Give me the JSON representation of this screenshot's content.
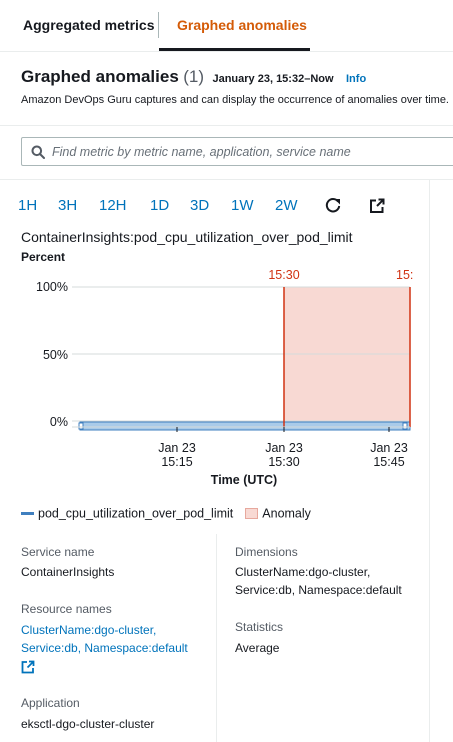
{
  "tabs": [
    {
      "label": "Aggregated metrics"
    },
    {
      "label": "Graphed anomalies"
    }
  ],
  "header": {
    "title": "Graphed anomalies",
    "count": "(1)",
    "date_range": "January 23, 15:32–Now",
    "info": "Info",
    "description": "Amazon DevOps Guru captures and can display the occurrence of anomalies over time."
  },
  "search": {
    "placeholder": "Find metric by metric name, application, service name"
  },
  "time_ranges": [
    "1H",
    "3H",
    "12H",
    "1D",
    "3D",
    "1W",
    "2W"
  ],
  "icons": {
    "refresh": "refresh-icon",
    "popout": "external-link-icon",
    "search": "search-icon"
  },
  "metric": {
    "name": "ContainerInsights:pod_cpu_utilization_over_pod_limit"
  },
  "chart_data": {
    "type": "line",
    "ylabel": "Percent",
    "xlabel": "Time (UTC)",
    "y_ticks": [
      "100%",
      "50%",
      "0%"
    ],
    "ylim": [
      0,
      100
    ],
    "x_ticks": [
      {
        "date": "Jan 23",
        "time": "15:15"
      },
      {
        "date": "Jan 23",
        "time": "15:30"
      },
      {
        "date": "Jan 23",
        "time": "15:45"
      }
    ],
    "series": [
      {
        "name": "pod_cpu_utilization_over_pod_limit",
        "x_start": "15:02",
        "x_end": "15:47",
        "values": [
          0,
          0
        ],
        "color": "#3f7fbf"
      }
    ],
    "anomaly": {
      "name": "Anomaly",
      "start": "15:30",
      "end": "15:47",
      "start_label": "15:30",
      "end_label": "15:",
      "color": "#f8d9d3",
      "line_color": "#d13212"
    },
    "grid": true,
    "legend": "bottom-left"
  },
  "details": {
    "service_name_label": "Service name",
    "service_name": "ContainerInsights",
    "resource_names_label": "Resource names",
    "resource_names_line1": "ClusterName:dgo-cluster,",
    "resource_names_line2": "Service:db, Namespace:default",
    "application_label": "Application",
    "application": "eksctl-dgo-cluster-cluster",
    "dimensions_label": "Dimensions",
    "dimensions_line1": "ClusterName:dgo-cluster,",
    "dimensions_line2": "Service:db, Namespace:default",
    "statistics_label": "Statistics",
    "statistics": "Average"
  },
  "colors": {
    "accent": "#d45b07",
    "link": "#0073bb",
    "anomaly_line": "#d13212",
    "anomaly_fill": "#f8d9d3",
    "series": "#3f7fbf"
  }
}
